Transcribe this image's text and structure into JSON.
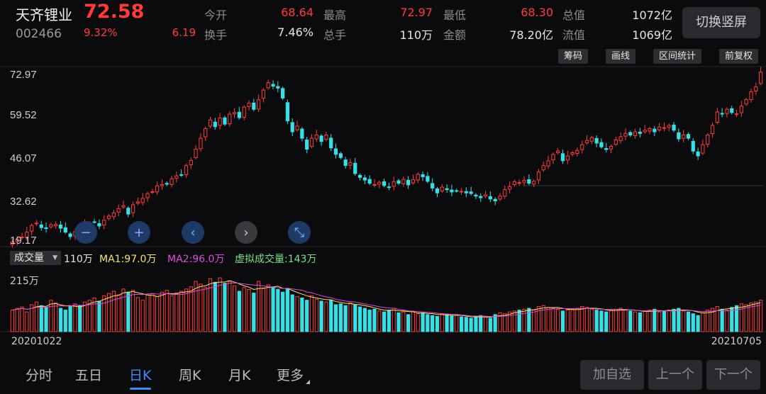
{
  "header": {
    "stock_name": "天齐锂业",
    "stock_code": "002466",
    "price": "72.58",
    "change_pct": "9.32%",
    "change_abs": "6.19",
    "quotes": [
      {
        "label": "今开",
        "value": "68.64",
        "color": "red"
      },
      {
        "label": "最高",
        "value": "72.97",
        "color": "red"
      },
      {
        "label": "最低",
        "value": "68.30",
        "color": "red"
      },
      {
        "label": "总值",
        "value": "1072亿",
        "color": "white"
      },
      {
        "label": "换手",
        "value": "7.46%",
        "color": "white"
      },
      {
        "label": "总手",
        "value": "110万",
        "color": "white"
      },
      {
        "label": "金额",
        "value": "78.20亿",
        "color": "white"
      },
      {
        "label": "流值",
        "value": "1069亿",
        "color": "white"
      }
    ],
    "switch_label": "切换竖屏"
  },
  "tools": [
    "筹码",
    "画线",
    "区间统计",
    "前复权"
  ],
  "controls": [
    {
      "icon": "zoom-out-icon",
      "glyph": "−"
    },
    {
      "icon": "zoom-in-icon",
      "glyph": "+"
    },
    {
      "icon": "chevron-left-icon",
      "glyph": "‹"
    },
    {
      "icon": "chevron-right-icon",
      "glyph": "›"
    },
    {
      "icon": "collapse-icon",
      "glyph": "⤡"
    }
  ],
  "indicator": {
    "selector": "成交量",
    "volume": "110万",
    "ma1": "MA1:97.0万",
    "ma2": "MA2:96.0万",
    "virtual": "虚拟成交量:143万",
    "vol_max_label": "215万"
  },
  "dates": {
    "start": "20201022",
    "end": "20210705"
  },
  "tabs": [
    {
      "label": "分时",
      "active": false
    },
    {
      "label": "五日",
      "active": false
    },
    {
      "label": "日K",
      "active": true
    },
    {
      "label": "周K",
      "active": false
    },
    {
      "label": "月K",
      "active": false
    },
    {
      "label": "更多",
      "active": false
    }
  ],
  "nav_buttons": [
    "加自选",
    "上一个",
    "下一个"
  ],
  "colors": {
    "up": "#ff3b3b",
    "down": "#35e0e6",
    "ma1": "#f5e36b",
    "ma2": "#d94ddc",
    "virtual": "#7ee08a",
    "accent": "#3d8bff"
  },
  "chart_data": {
    "type": "candlestick",
    "y_ticks": [
      "72.97",
      "59.52",
      "46.07",
      "32.62",
      "19.17"
    ],
    "ylim": [
      19.17,
      72.97
    ],
    "x_range": [
      "20201022",
      "20210705"
    ],
    "closes": [
      19.8,
      20.6,
      21.3,
      22.8,
      24.9,
      25.6,
      24.2,
      23.9,
      25.1,
      25.2,
      24.0,
      22.8,
      21.4,
      23.0,
      22.7,
      25.1,
      25.6,
      26.0,
      24.7,
      26.5,
      27.8,
      28.8,
      30.1,
      31.0,
      28.4,
      31.3,
      32.2,
      33.3,
      34.8,
      35.4,
      37.2,
      37.6,
      37.7,
      39.4,
      40.3,
      40.6,
      43.5,
      45.1,
      48.6,
      52.0,
      55.0,
      57.7,
      55.6,
      58.3,
      56.4,
      59.5,
      60.0,
      58.4,
      61.7,
      62.9,
      61.0,
      64.0,
      67.0,
      69.3,
      68.2,
      67.6,
      64.5,
      57.4,
      54.0,
      55.8,
      52.0,
      48.6,
      52.0,
      53.0,
      51.0,
      53.0,
      49.0,
      47.0,
      46.0,
      43.5,
      44.4,
      41.0,
      39.8,
      39.0,
      38.0,
      37.6,
      38.3,
      37.3,
      36.8,
      38.5,
      38.0,
      39.2,
      37.5,
      39.1,
      40.8,
      40.0,
      38.6,
      36.5,
      35.0,
      36.8,
      36.0,
      35.3,
      35.7,
      35.5,
      35.0,
      34.8,
      34.0,
      33.5,
      34.4,
      33.1,
      32.5,
      34.0,
      36.0,
      37.0,
      38.5,
      38.2,
      38.9,
      38.0,
      38.6,
      41.5,
      43.5,
      45.0,
      47.0,
      48.0,
      45.0,
      46.5,
      47.5,
      48.2,
      50.0,
      51.3,
      52.2,
      50.5,
      49.3,
      48.5,
      49.5,
      51.5,
      52.5,
      53.5,
      53.0,
      54.0,
      53.5,
      54.5,
      55.0,
      54.0,
      55.5,
      55.3,
      56.0,
      54.5,
      51.8,
      53.0,
      52.0,
      48.0,
      46.5,
      50.0,
      53.0,
      56.0,
      60.2,
      59.5,
      61.0,
      60.0,
      59.6,
      62.0,
      64.0,
      66.5,
      68.0,
      72.58
    ],
    "volumes": [
      48,
      52,
      55,
      44,
      60,
      66,
      58,
      54,
      70,
      64,
      52,
      48,
      56,
      62,
      58,
      66,
      70,
      75,
      68,
      80,
      85,
      90,
      82,
      95,
      88,
      92,
      76,
      70,
      82,
      85,
      78,
      88,
      92,
      80,
      86,
      90,
      95,
      100,
      112,
      106,
      98,
      118,
      110,
      120,
      108,
      112,
      102,
      90,
      98,
      94,
      86,
      112,
      96,
      104,
      100,
      94,
      88,
      95,
      82,
      78,
      75,
      70,
      80,
      72,
      68,
      66,
      70,
      60,
      62,
      58,
      64,
      60,
      55,
      52,
      48,
      50,
      46,
      44,
      48,
      52,
      42,
      44,
      38,
      45,
      40,
      42,
      38,
      36,
      34,
      40,
      38,
      35,
      36,
      33,
      32,
      30,
      34,
      36,
      32,
      30,
      38,
      42,
      40,
      44,
      46,
      48,
      50,
      52,
      48,
      56,
      58,
      54,
      52,
      50,
      46,
      48,
      50,
      52,
      56,
      54,
      50,
      48,
      46,
      44,
      48,
      50,
      52,
      48,
      46,
      44,
      42,
      46,
      48,
      50,
      44,
      46,
      48,
      50,
      52,
      46,
      44,
      40,
      36,
      42,
      48,
      52,
      56,
      50,
      48,
      54,
      58,
      62,
      60,
      64,
      66,
      70
    ],
    "volume_label": "110万"
  }
}
